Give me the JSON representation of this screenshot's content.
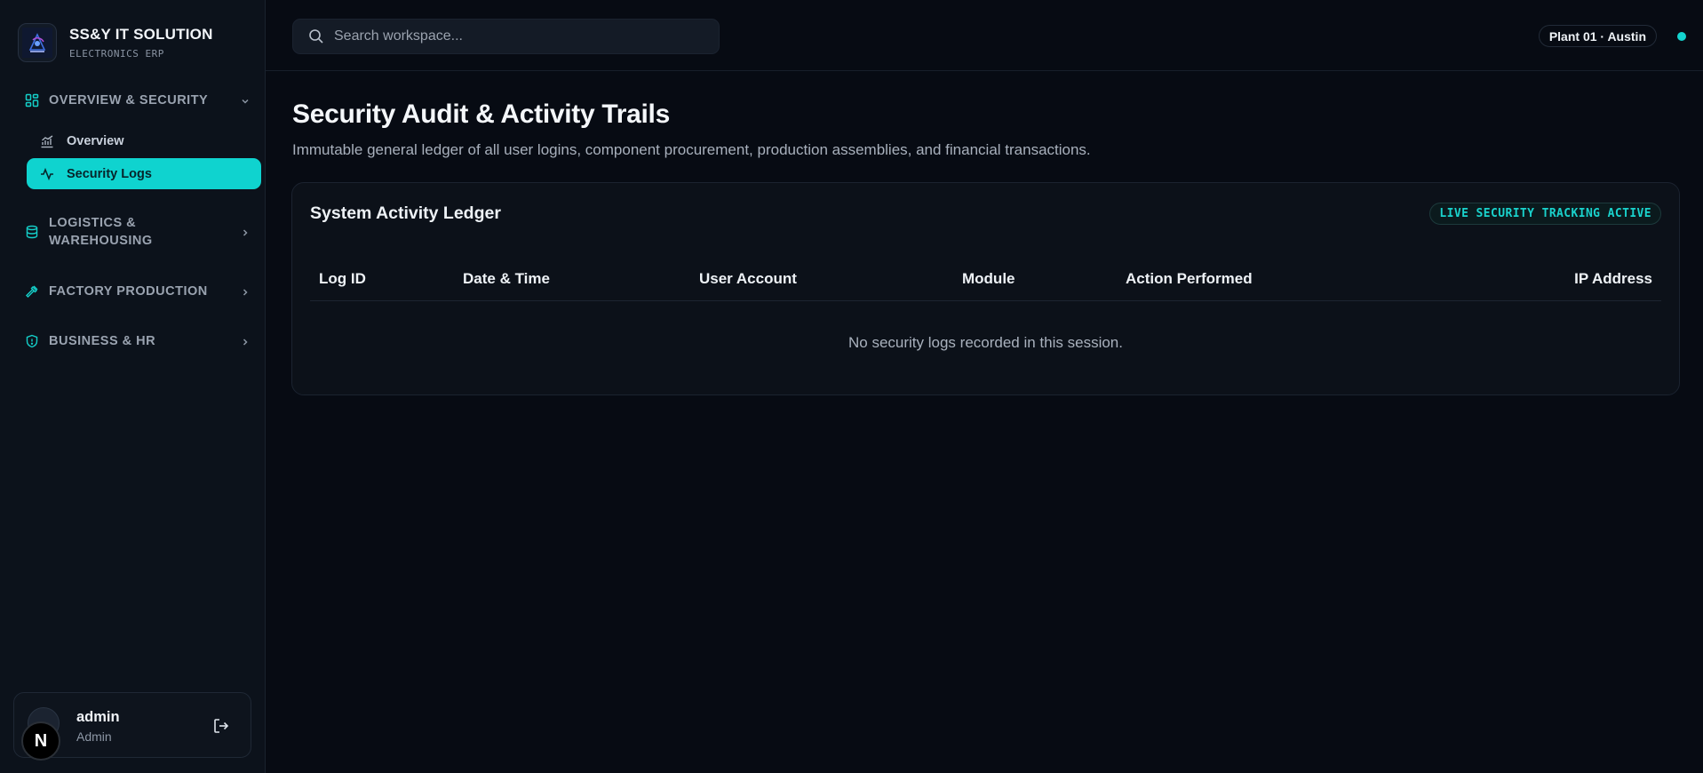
{
  "brand": {
    "title": "SS&Y IT SOLUTION",
    "subtitle": "ELECTRONICS ERP"
  },
  "sidebar": {
    "groups": [
      {
        "label": "OVERVIEW & SECURITY",
        "icon": "dashboard-grid-icon",
        "expanded": true,
        "items": [
          {
            "label": "Overview",
            "icon": "chart-line-icon",
            "active": false
          },
          {
            "label": "Security Logs",
            "icon": "activity-pulse-icon",
            "active": true
          }
        ]
      },
      {
        "label": "LOGISTICS & WAREHOUSING",
        "icon": "database-icon",
        "expanded": false
      },
      {
        "label": "FACTORY PRODUCTION",
        "icon": "hammer-icon",
        "expanded": false
      },
      {
        "label": "BUSINESS & HR",
        "icon": "shield-icon",
        "expanded": false
      }
    ]
  },
  "user": {
    "name": "admin",
    "role": "Admin"
  },
  "search": {
    "placeholder": "Search workspace..."
  },
  "header": {
    "location": "Plant 01 · Austin"
  },
  "page": {
    "title": "Security Audit & Activity Trails",
    "subtitle": "Immutable general ledger of all user logins, component procurement, production assemblies, and financial transactions."
  },
  "ledger": {
    "title": "System Activity Ledger",
    "badge": "LIVE SECURITY TRACKING ACTIVE",
    "columns": [
      "Log ID",
      "Date & Time",
      "User Account",
      "Module",
      "Action Performed",
      "IP Address"
    ],
    "empty_message": "No security logs recorded in this session."
  },
  "colors": {
    "accent": "#0fd3cf",
    "background": "#070b13",
    "sidebar": "#0c121b"
  }
}
